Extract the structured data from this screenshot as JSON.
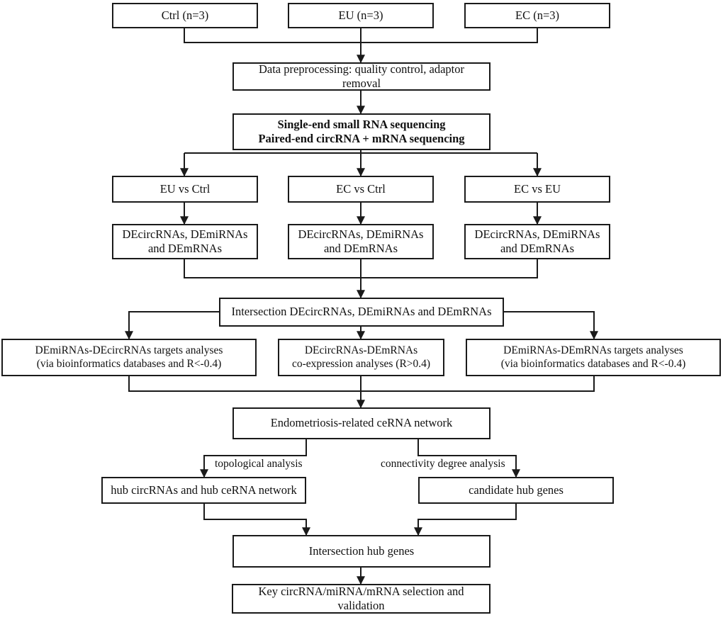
{
  "diagram": {
    "title": "Endometriosis ceRNA study workflow",
    "line_color": "#1a1a1a",
    "box_fill": "#ffffff",
    "text_color": "#111111"
  },
  "nodes": {
    "ctrl": "Ctrl (n=3)",
    "eu": "EU (n=3)",
    "ec": "EC (n=3)",
    "preprocessing": "Data preprocessing: quality control, adaptor removal",
    "sequencing": "Single-end small RNA sequencing\nPaired-end circRNA + mRNA sequencing",
    "eu_vs_ctrl": "EU vs Ctrl",
    "ec_vs_ctrl": "EC vs Ctrl",
    "ec_vs_eu": "EC vs EU",
    "de_left": "DEcircRNAs, DEmiRNAs\nand DEmRNAs",
    "de_mid": "DEcircRNAs, DEmiRNAs\nand DEmRNAs",
    "de_right": "DEcircRNAs, DEmiRNAs\nand DEmRNAs",
    "intersection_de": "Intersection DEcircRNAs, DEmiRNAs and DEmRNAs",
    "analysis_left": "DEmiRNAs-DEcircRNAs targets analyses\n(via bioinformatics databases and R<-0.4)",
    "analysis_mid": "DEcircRNAs-DEmRNAs\nco-expression analyses (R>0.4)",
    "analysis_right": "DEmiRNAs-DEmRNAs targets analyses\n(via bioinformatics databases and R<-0.4)",
    "cerna_network": "Endometriosis-related ceRNA network",
    "hub_circ": "hub circRNAs and hub ceRNA network",
    "candidate_hub": "candidate hub genes",
    "intersection_hub": "Intersection hub genes",
    "key_selection": "Key circRNA/miRNA/mRNA selection and validation"
  },
  "edge_labels": {
    "topological": "topological analysis",
    "connectivity": "connectivity degree analysis"
  }
}
